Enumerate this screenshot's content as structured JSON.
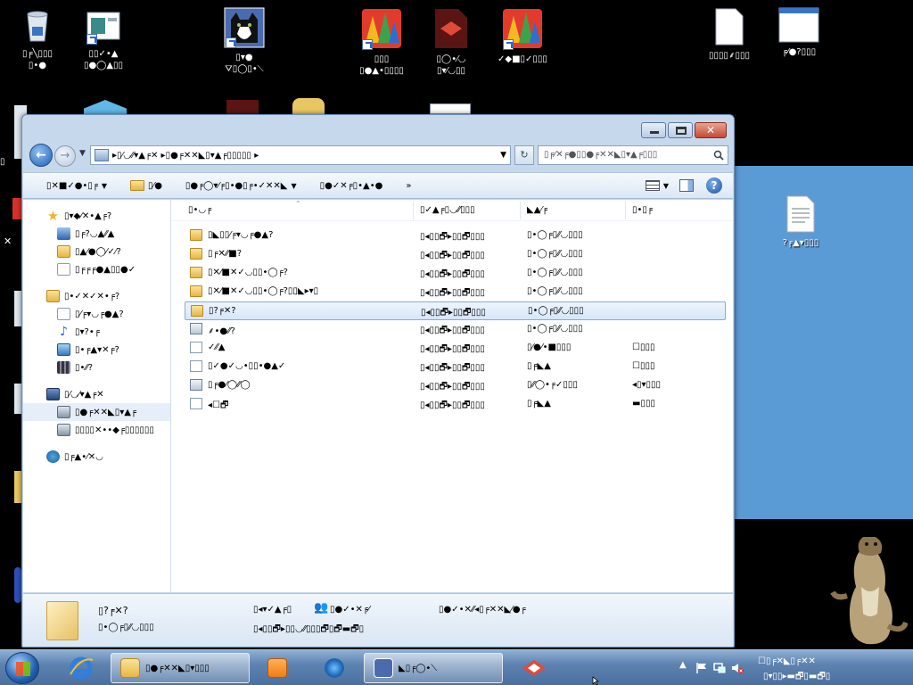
{
  "desktop": {
    "icons": [
      {
        "name": "recycle-bin",
        "label1": "▯╒╲▯▯▯",
        "label2": "▯•●"
      },
      {
        "name": "control-panel",
        "label1": "▯▯✓•▲",
        "label2": "▯●◯▲▯▯"
      },
      {
        "name": "cat-app",
        "label1": "▯▾●",
        "label2": "⛛▯◯▯•⟍"
      },
      {
        "name": "avg",
        "label1": "▯▯▯",
        "label2": "▯●▲•▯▯▯▯"
      },
      {
        "name": "red-app",
        "label1": "▯◯•⁄◡",
        "label2": "▯▾⁄◡▯▯"
      },
      {
        "name": "avg-2",
        "label1": "✓◆■▯✓▯▯▯",
        "label2": ""
      },
      {
        "name": "file-1",
        "label1": "▯▯▯▯⸙▯▯▯",
        "label2": ""
      },
      {
        "name": "window-file",
        "label1": "╒⁄●?▯▯▯",
        "label2": ""
      }
    ],
    "right_file_label": "?╒▲▾▯▯▯"
  },
  "window": {
    "address_text": "▸▯⁄◡⁄⁄▾▲╒✕ ▸▯●╒✕✕◣▯▾▲╒▯▯▯▯▯ ▸",
    "search_placeholder": "▯╒⁄✕╒●▯▯●╒✕✕◣▯▾▲╒▯▯▯",
    "toolbar": {
      "organize": "▯✕■✓●•▯╒",
      "open": "▯⁄●",
      "share": "▯●╒◯▾⁄╒▯•●▯╒•✓✕✕◣",
      "burn": "▯●✓✕╒▯•▲•●",
      "more": "»"
    },
    "nav": {
      "favorites": {
        "label": "▯▾◆⁄✕•▲╒?",
        "items": [
          "▯╒?◡▲⁄⁄▲",
          "▯▲⁄●◯⁄✓⁄?",
          "▯╒╒╒●▲▯▯●✓"
        ]
      },
      "libraries": {
        "label": "▯•✓✕✓✕•╒?",
        "items": [
          "▯⁄╒▾◡╒●▲?",
          "▯▾?•╒",
          "▯•╒▲▾✕╒?",
          "▯•⁄⁄?"
        ]
      },
      "computer": {
        "label": "▯⁄◡⁄▾▲╒✕",
        "items": [
          "▯●╒✕✕◣▯▾▲╒",
          "▯▯▯▯✕••◆╒▯▯▯▯▯▯"
        ]
      },
      "network": {
        "label": "▯╒▲•⁄✕◡"
      }
    },
    "columns": {
      "name": "▯•◡╒",
      "date": "▯✓▲╒▯◡⁄⁄▯▯▯",
      "type": "◣▲⁄╒",
      "size": "▯•▯╒"
    },
    "files": [
      {
        "name": "▯◣▯▯⁄╒▾◡╒●▲?",
        "date": "▯◂▯▯🗗▸▯▯🗗▯▯▯",
        "type": "▯•◯╒▯⁄⁄◡▯▯▯",
        "size": "",
        "icon": "folder"
      },
      {
        "name": "▯╒✕⁄⁄■?",
        "date": "▯◂▯▯🗗▸▯▯🗗▯▯▯",
        "type": "▯•◯╒▯⁄⁄◡▯▯▯",
        "size": "",
        "icon": "folder"
      },
      {
        "name": "▯✕⁄■✕✓◡▯▯•◯╒?",
        "date": "▯◂▯▯🗗▸▯▯🗗▯▯▯",
        "type": "▯•◯╒▯⁄⁄◡▯▯▯",
        "size": "",
        "icon": "folder"
      },
      {
        "name": "▯✕⁄■✕✓◡▯▯•◯╒?▯▯◣▸▾▯",
        "date": "▯◂▯▯🗗▸▯▯🗗▯▯▯",
        "type": "▯•◯╒▯⁄⁄◡▯▯▯",
        "size": "",
        "icon": "folder"
      },
      {
        "name": "▯?╒✕?",
        "date": "▯◂▯▯🗗▸▯▯🗗▯▯▯",
        "type": "▯•◯╒▯⁄⁄◡▯▯▯",
        "size": "",
        "icon": "folder",
        "selected": true
      },
      {
        "name": "⸙•●⁄⁄?",
        "date": "▯◂▯▯🗗▸▯▯🗗▯▯▯",
        "type": "▯•◯╒▯⁄⁄◡▯▯▯",
        "size": "",
        "icon": "config"
      },
      {
        "name": "✓⁄⁄▲",
        "date": "▯◂▯▯🗗▸▯▯🗗▯▯▯",
        "type": "▯⁄●⁄•■▯▯▯",
        "size": "☐▯▯▯",
        "icon": "doc"
      },
      {
        "name": "▯✓●✓◡•▯▯•●▲✓",
        "date": "▯◂▯▯🗗▸▯▯🗗▯▯▯",
        "type": "▯╒◣▲",
        "size": "☐▯▯▯",
        "icon": "doc"
      },
      {
        "name": "▯╒●⁄◯⁄⁄◯",
        "date": "▯◂▯▯🗗▸▯▯🗗▯▯▯",
        "type": "▯⁄⁄◯•╒✓▯▯▯",
        "size": "◂▯▾▯▯▯",
        "icon": "config"
      },
      {
        "name": "◂☐🗗",
        "date": "▯◂▯▯🗗▸▯▯🗗▯▯▯",
        "type": "▯╒◣▲",
        "size": "▬▯▯▯",
        "icon": "doc"
      }
    ],
    "details": {
      "name": "▯?╒✕?",
      "type": "▯•◯╒▯⁄⁄◡▯▯▯",
      "date_label": "▯◂▾✓▲╒▯",
      "date": "▯◂▯▯🗗▸▯▯◡⁄⁄▯▯▯🗗▯🗗▬🗗▯",
      "shared_label": "▯●✓•✕╒⁄",
      "shared_value": "▯●✓•✕⁄⁄◂▯╒✕✕◣⁄●╒"
    }
  },
  "taskbar": {
    "explorer_task": "▯●╒✕✕◣▯▾▯▯▯",
    "cat_task": "◣▯╒◯•⟍",
    "clock_time": "☐▯╒✕◣▯╒✕✕",
    "clock_date": "▯▾▯▯▸▬🗗▯▬🗗▯"
  }
}
